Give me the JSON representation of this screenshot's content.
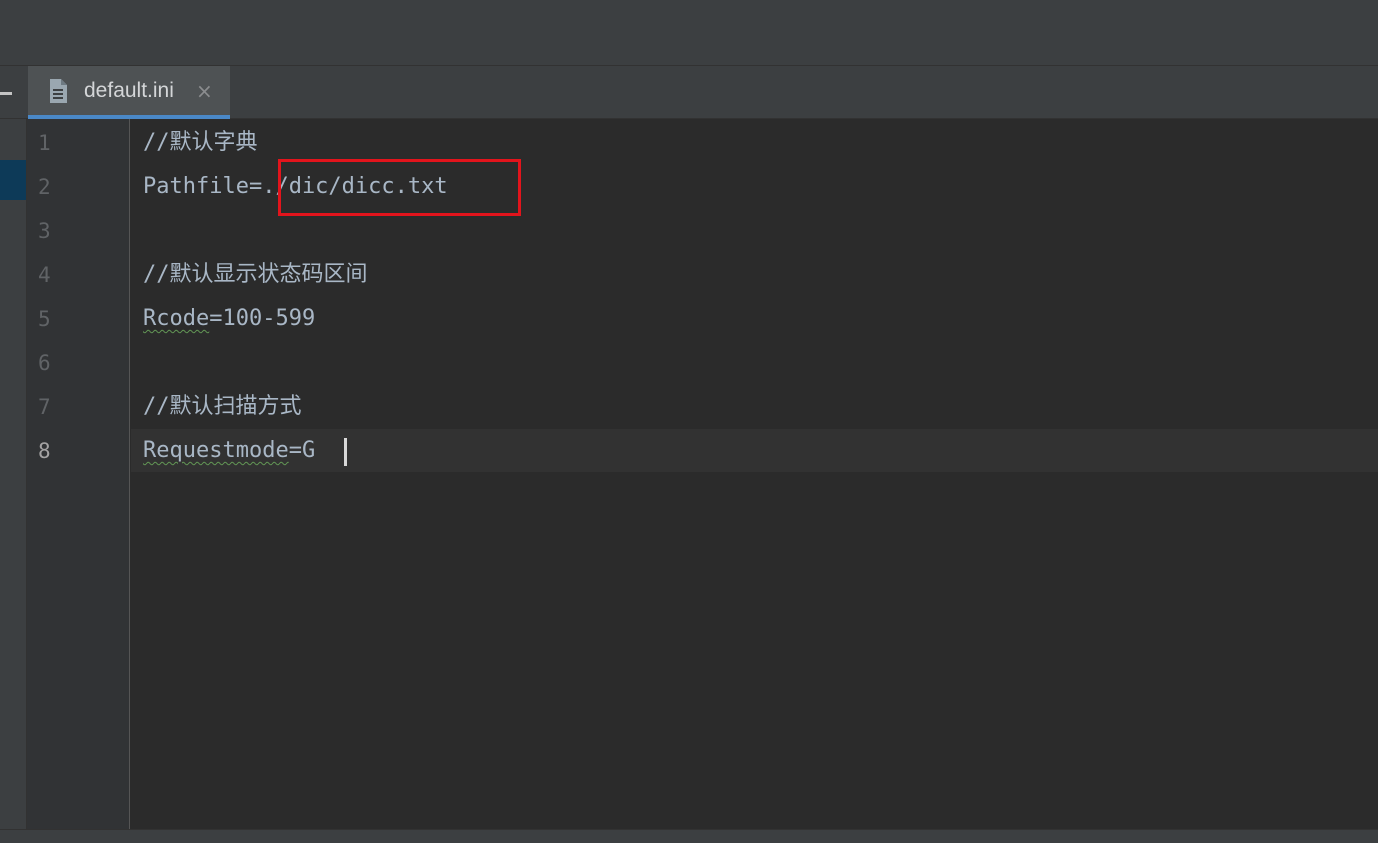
{
  "tab": {
    "label": "default.ini",
    "close_glyph": "×",
    "icon": "text-file-icon"
  },
  "gutter": {
    "line_numbers": [
      "1",
      "2",
      "3",
      "4",
      "5",
      "6",
      "7",
      "8"
    ],
    "active_line": "8"
  },
  "code": {
    "lines": [
      "//默认字典",
      "Pathfile=./dic/dicc.txt",
      "",
      "//默认显示状态码区间",
      "Rcode=100-599",
      "",
      "//默认扫描方式",
      "Requestmode=G"
    ],
    "rcode_key": "Rcode",
    "rcode_rest": "=100-599",
    "requestmode_key": "Requestmode",
    "requestmode_rest": "=G"
  },
  "annotation": {
    "color": "#e2141c",
    "highlighted_value": "./dic/dicc.txt"
  },
  "colors": {
    "tab_underline": "#4a88c7",
    "code_text": "#a9b7c6",
    "spelling_squiggle": "#629755"
  }
}
